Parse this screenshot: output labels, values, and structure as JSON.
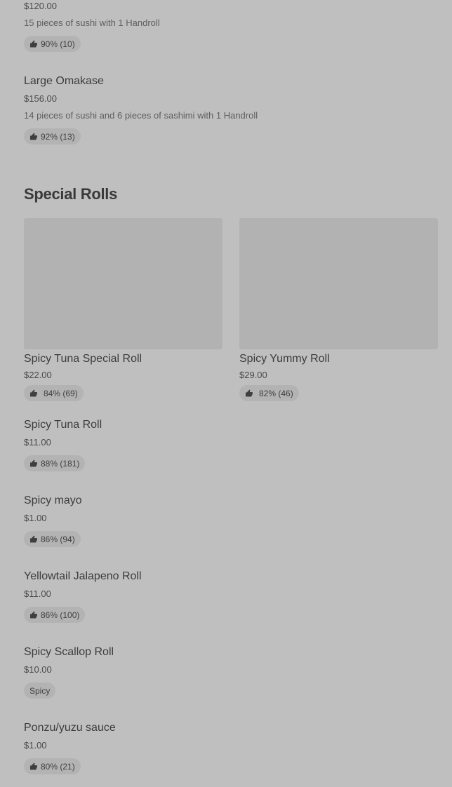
{
  "partial_item": {
    "price": "$120.00",
    "description": "15 pieces of sushi with 1 Handroll",
    "rating": "90% (10)"
  },
  "large_omakase": {
    "name": "Large Omakase",
    "price": "$156.00",
    "description": "14 pieces of sushi and 6 pieces of sashimi with 1 Handroll",
    "rating": "92% (13)"
  },
  "section": {
    "title": "Special Rolls"
  },
  "featured": [
    {
      "name": "Spicy Tuna Special Roll",
      "price": "$22.00",
      "rating": "84% (69)"
    },
    {
      "name": "Spicy Yummy Roll",
      "price": "$29.00",
      "rating": "82% (46)"
    }
  ],
  "items": [
    {
      "name": "Spicy Tuna Roll",
      "price": "$11.00",
      "rating": "88% (181)"
    },
    {
      "name": "Spicy mayo",
      "price": "$1.00",
      "rating": "86% (94)"
    },
    {
      "name": "Yellowtail Jalapeno Roll",
      "price": "$11.00",
      "rating": "86% (100)"
    },
    {
      "name": "Spicy Scallop Roll",
      "price": "$10.00",
      "tag": "Spicy"
    },
    {
      "name": "Ponzu/yuzu sauce",
      "price": "$1.00",
      "rating": "80% (21)"
    }
  ],
  "icons": {
    "rating": "thumbs-up-icon",
    "color": "#3f3f3f"
  }
}
